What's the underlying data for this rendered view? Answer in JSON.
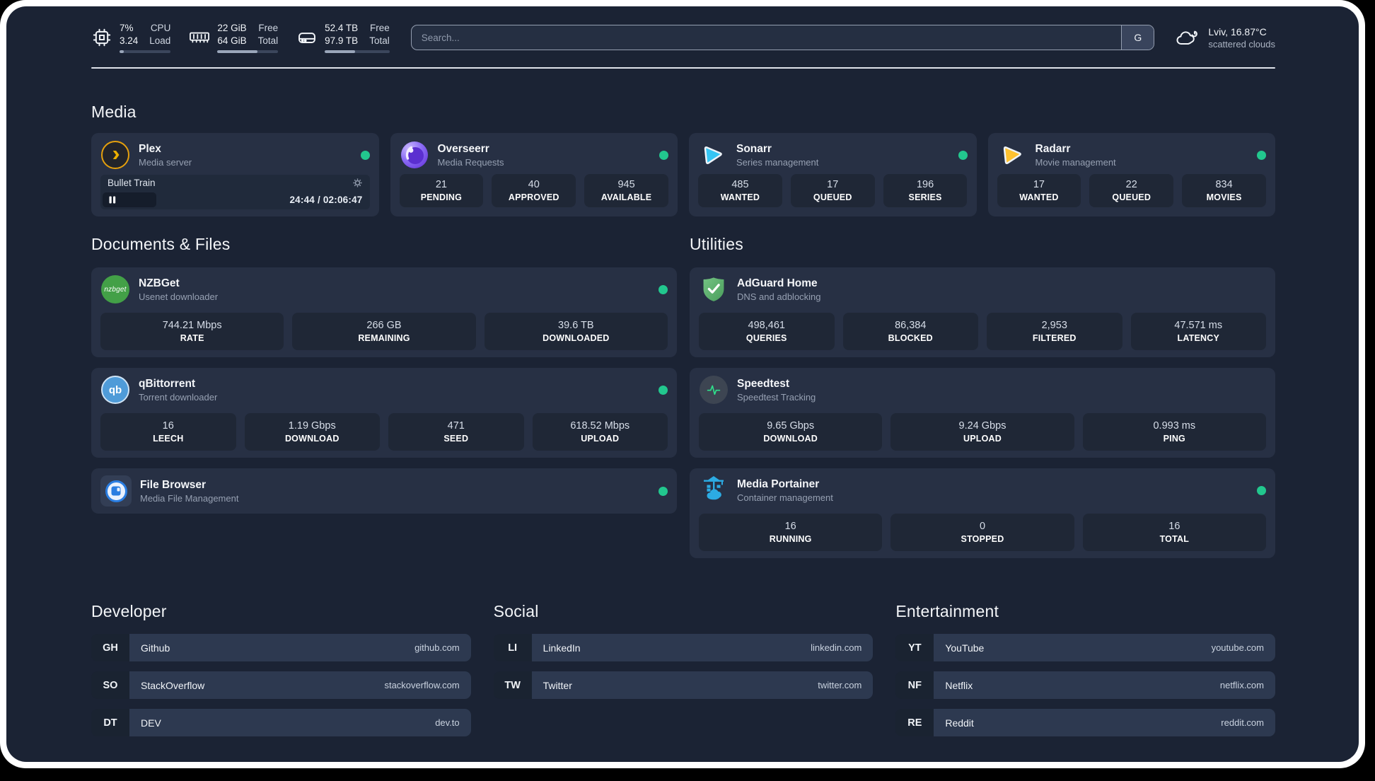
{
  "topbar": {
    "stats": [
      {
        "icon": "cpu-icon",
        "values": [
          "7%",
          "3.24"
        ],
        "labels": [
          "CPU",
          "Load"
        ],
        "progress": 8
      },
      {
        "icon": "ram-icon",
        "values": [
          "22 GiB",
          "64 GiB"
        ],
        "labels": [
          "Free",
          "Total"
        ],
        "progress": 66
      },
      {
        "icon": "disk-icon",
        "values": [
          "52.4 TB",
          "97.9 TB"
        ],
        "labels": [
          "Free",
          "Total"
        ],
        "progress": 47
      }
    ],
    "search": {
      "placeholder": "Search...",
      "button_label": "G"
    },
    "weather": {
      "location": "Lviv, 16.87°C",
      "condition": "scattered clouds"
    }
  },
  "media": {
    "title": "Media",
    "plex": {
      "name": "Plex",
      "desc": "Media server",
      "now_playing": "Bullet Train",
      "time": "24:44 / 02:06:47",
      "progress": 20
    },
    "overseerr": {
      "name": "Overseerr",
      "desc": "Media Requests",
      "stats": [
        {
          "value": "21",
          "label": "PENDING"
        },
        {
          "value": "40",
          "label": "APPROVED"
        },
        {
          "value": "945",
          "label": "AVAILABLE"
        }
      ]
    },
    "sonarr": {
      "name": "Sonarr",
      "desc": "Series management",
      "stats": [
        {
          "value": "485",
          "label": "WANTED"
        },
        {
          "value": "17",
          "label": "QUEUED"
        },
        {
          "value": "196",
          "label": "SERIES"
        }
      ]
    },
    "radarr": {
      "name": "Radarr",
      "desc": "Movie management",
      "stats": [
        {
          "value": "17",
          "label": "WANTED"
        },
        {
          "value": "22",
          "label": "QUEUED"
        },
        {
          "value": "834",
          "label": "MOVIES"
        }
      ]
    }
  },
  "documents": {
    "title": "Documents & Files",
    "nzbget": {
      "name": "NZBGet",
      "desc": "Usenet downloader",
      "icon_text": "nzbget",
      "stats": [
        {
          "value": "744.21 Mbps",
          "label": "RATE"
        },
        {
          "value": "266 GB",
          "label": "REMAINING"
        },
        {
          "value": "39.6 TB",
          "label": "DOWNLOADED"
        }
      ]
    },
    "qbittorrent": {
      "name": "qBittorrent",
      "desc": "Torrent downloader",
      "icon_text": "qb",
      "stats": [
        {
          "value": "16",
          "label": "LEECH"
        },
        {
          "value": "1.19 Gbps",
          "label": "DOWNLOAD"
        },
        {
          "value": "471",
          "label": "SEED"
        },
        {
          "value": "618.52 Mbps",
          "label": "UPLOAD"
        }
      ]
    },
    "filebrowser": {
      "name": "File Browser",
      "desc": "Media File Management"
    }
  },
  "utilities": {
    "title": "Utilities",
    "adguard": {
      "name": "AdGuard Home",
      "desc": "DNS and adblocking",
      "stats": [
        {
          "value": "498,461",
          "label": "QUERIES"
        },
        {
          "value": "86,384",
          "label": "BLOCKED"
        },
        {
          "value": "2,953",
          "label": "FILTERED"
        },
        {
          "value": "47.571 ms",
          "label": "LATENCY"
        }
      ]
    },
    "speedtest": {
      "name": "Speedtest",
      "desc": "Speedtest Tracking",
      "stats": [
        {
          "value": "9.65 Gbps",
          "label": "DOWNLOAD"
        },
        {
          "value": "9.24 Gbps",
          "label": "UPLOAD"
        },
        {
          "value": "0.993 ms",
          "label": "PING"
        }
      ]
    },
    "portainer": {
      "name": "Media Portainer",
      "desc": "Container management",
      "stats": [
        {
          "value": "16",
          "label": "RUNNING"
        },
        {
          "value": "0",
          "label": "STOPPED"
        },
        {
          "value": "16",
          "label": "TOTAL"
        }
      ]
    }
  },
  "links": {
    "developer": {
      "title": "Developer",
      "items": [
        {
          "abbr": "GH",
          "name": "Github",
          "url": "github.com"
        },
        {
          "abbr": "SO",
          "name": "StackOverflow",
          "url": "stackoverflow.com"
        },
        {
          "abbr": "DT",
          "name": "DEV",
          "url": "dev.to"
        }
      ]
    },
    "social": {
      "title": "Social",
      "items": [
        {
          "abbr": "LI",
          "name": "LinkedIn",
          "url": "linkedin.com"
        },
        {
          "abbr": "TW",
          "name": "Twitter",
          "url": "twitter.com"
        }
      ]
    },
    "entertainment": {
      "title": "Entertainment",
      "items": [
        {
          "abbr": "YT",
          "name": "YouTube",
          "url": "youtube.com"
        },
        {
          "abbr": "NF",
          "name": "Netflix",
          "url": "netflix.com"
        },
        {
          "abbr": "RE",
          "name": "Reddit",
          "url": "reddit.com"
        }
      ]
    }
  },
  "colors": {
    "status_green": "#22c78e",
    "plex_gold": "#e5a00d",
    "sonarr_blue": "#35c5f4",
    "radarr_yellow": "#ffc230",
    "nzbget_green": "#43a047",
    "qbittorrent_blue": "#4f9bd8",
    "filebrowser_blue": "#2a7de1",
    "adguard_green": "#67b279",
    "speedtest_green": "#2fe08c",
    "portainer_blue": "#2cabe3"
  }
}
